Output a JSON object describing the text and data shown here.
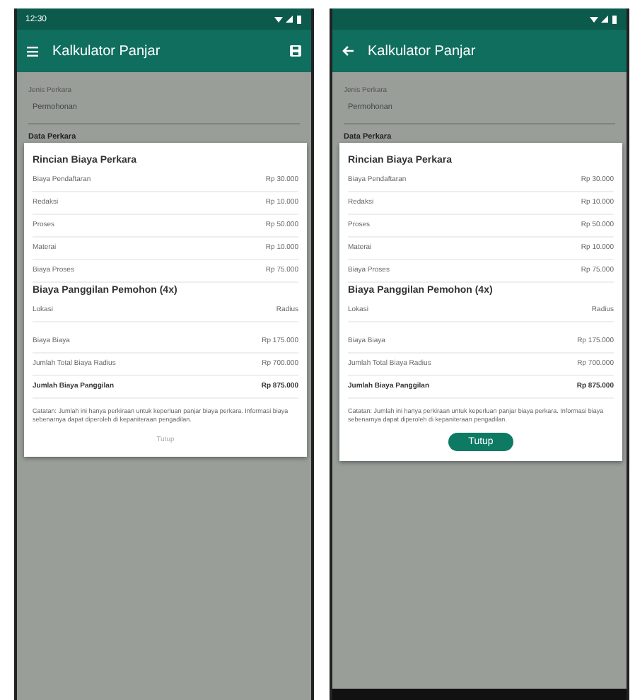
{
  "phones": [
    {
      "status_bar": {
        "time": "12:30"
      },
      "app_bar": {
        "kind": "menu",
        "title": "Kalkulator Panjar",
        "action_icon": true
      },
      "form": {
        "field_label": "Jenis Perkara",
        "field_value": "Permohonan",
        "section_label": "Data Perkara"
      },
      "dialog": {
        "sections": [
          {
            "title": "Rincian Biaya Perkara",
            "rows": [
              {
                "label": "Biaya Pendaftaran",
                "value": "Rp 30.000"
              },
              {
                "label": "Redaksi",
                "value": "Rp 10.000"
              },
              {
                "label": "Proses",
                "value": "Rp 50.000"
              },
              {
                "label": "Materai",
                "value": "Rp 10.000"
              },
              {
                "label": "Biaya Proses",
                "value": "Rp 75.000"
              }
            ]
          },
          {
            "title": "Biaya Panggilan Pemohon (4x)",
            "rows": [
              {
                "label": "Lokasi",
                "value": "Radius"
              }
            ]
          }
        ],
        "totals": [
          {
            "label": "Biaya Biaya",
            "value": "Rp 175.000",
            "bold": false
          },
          {
            "label": "Jumlah Total Biaya Radius",
            "value": "Rp 700.000",
            "bold": false
          },
          {
            "label": "Jumlah Biaya Panggilan",
            "value": "Rp 875.000",
            "bold": true
          }
        ],
        "note": "Catatan: Jumlah ini hanya perkiraan untuk keperluan panjar biaya perkara. Informasi biaya sebenarnya dapat diperoleh di kepaniteraan pengadilan.",
        "close_button": {
          "kind": "text",
          "label": "Tutup"
        }
      },
      "nav_bar": false
    },
    {
      "app_bar": {
        "kind": "back",
        "title": "Kalkulator Panjar",
        "action_icon": false
      },
      "form": {
        "field_label": "Jenis Perkara",
        "field_value": "Permohonan",
        "section_label": "Data Perkara"
      },
      "dialog": {
        "sections": [
          {
            "title": "Rincian Biaya Perkara",
            "rows": [
              {
                "label": "Biaya Pendaftaran",
                "value": "Rp 30.000"
              },
              {
                "label": "Redaksi",
                "value": "Rp 10.000"
              },
              {
                "label": "Proses",
                "value": "Rp 50.000"
              },
              {
                "label": "Materai",
                "value": "Rp 10.000"
              },
              {
                "label": "Biaya Proses",
                "value": "Rp 75.000"
              }
            ]
          },
          {
            "title": "Biaya Panggilan Pemohon (4x)",
            "rows": [
              {
                "label": "Lokasi",
                "value": "Radius"
              }
            ]
          }
        ],
        "totals": [
          {
            "label": "Biaya Biaya",
            "value": "Rp 175.000",
            "bold": false
          },
          {
            "label": "Jumlah Total Biaya Radius",
            "value": "Rp 700.000",
            "bold": false
          },
          {
            "label": "Jumlah Biaya Panggilan",
            "value": "Rp 875.000",
            "bold": true
          }
        ],
        "note": "Catatan: Jumlah ini hanya perkiraan untuk keperluan panjar biaya perkara. Informasi biaya sebenarnya dapat diperoleh di kepaniteraan pengadilan.",
        "close_button": {
          "kind": "filled",
          "label": "Tutup"
        }
      },
      "nav_bar": true
    }
  ]
}
